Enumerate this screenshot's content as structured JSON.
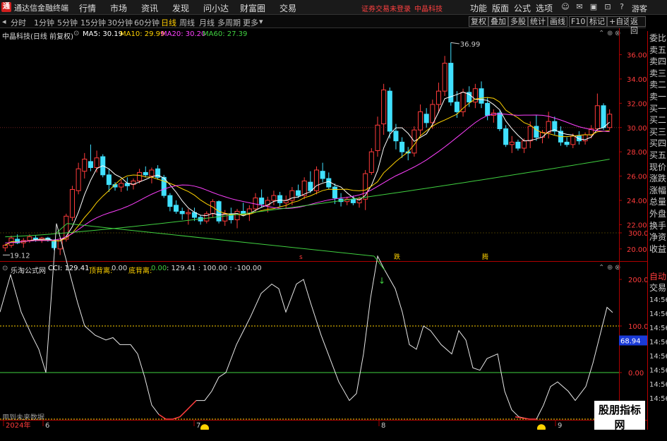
{
  "app": {
    "name": "通达信金融终端",
    "logo_char": "通"
  },
  "menu": [
    "行情",
    "市场",
    "资讯",
    "发现",
    "问小达",
    "财富圈",
    "交易"
  ],
  "login_status": "证券交易未登录",
  "stock_short": "中晶科技",
  "right_menu": [
    "功能",
    "版面",
    "公式",
    "选项"
  ],
  "guest": "游客",
  "periods": [
    "分时",
    "1分钟",
    "5分钟",
    "15分钟",
    "30分钟",
    "60分钟",
    "日线",
    "周线",
    "月线",
    "多周期",
    "更多"
  ],
  "active_period": "日线",
  "right_tools": [
    "复权",
    "叠加",
    "多股",
    "统计",
    "画线",
    "F10",
    "标记",
    "+自选",
    "返回"
  ],
  "main": {
    "title": "中晶科技(日线 前复权)",
    "ma": [
      {
        "label": "MA5: 30.19",
        "color": "#ffffff"
      },
      {
        "label": "MA10: 29.99",
        "color": "#ffd200"
      },
      {
        "label": "MA20: 30.20",
        "color": "#ff40ff"
      },
      {
        "label": "MA60: 27.39",
        "color": "#40d040"
      }
    ],
    "y_ticks": [
      "36.00",
      "34.00",
      "32.00",
      "30.00",
      "28.00",
      "26.00",
      "24.00",
      "22.00",
      "20.00"
    ],
    "high_label": "36.99",
    "low_label": "19.12",
    "markers": [
      "s",
      "跌",
      "腾"
    ]
  },
  "indicator": {
    "name": "乐淘公式网",
    "cci": "CCI: 129.41",
    "top_div_label": "顶背离:",
    "top_div_val": "0.00",
    "bot_div_label": "底背离:",
    "bot_div_val": "0.00",
    "rest": ": 129.41 : 100.00 : -100.00",
    "y_ticks": [
      "300.0",
      "200.0",
      "100.0",
      "0.00"
    ],
    "current_value": "68.94",
    "footer": "用到未来数据"
  },
  "x_axis": [
    "2024年",
    "6",
    "7",
    "8",
    "9"
  ],
  "side_panel": [
    "委比",
    "卖五",
    "卖四",
    "卖三",
    "卖二",
    "卖一",
    "买一",
    "买二",
    "买三",
    "买四",
    "买五",
    "现价",
    "涨跌",
    "涨幅",
    "总量",
    "外盘",
    "换手",
    "净资",
    "收益"
  ],
  "side_bottom": [
    "自动",
    "交易"
  ],
  "side_times": [
    "14:56",
    "14:56",
    "14:56",
    "14:56",
    "14:56",
    "14:56",
    "14:56",
    "14:56"
  ],
  "watermark": {
    "line1": "股朋指标网",
    "line2": "www.7gpzb.com"
  },
  "colors": {
    "up": "#ff3b3b",
    "down": "#40e0ff",
    "ma5": "#ffffff",
    "ma10": "#ffd200",
    "ma20": "#ff40ff",
    "ma60": "#40d040"
  },
  "chart_data": {
    "type": "candlestick",
    "price_ylim": [
      19.0,
      37.6
    ],
    "candles": [
      [
        20.1,
        20.4,
        19.8,
        20.3
      ],
      [
        20.3,
        21.1,
        20.1,
        20.9
      ],
      [
        20.8,
        21.2,
        20.4,
        20.5
      ],
      [
        20.5,
        20.9,
        20.1,
        20.7
      ],
      [
        20.7,
        21.2,
        20.5,
        21.0
      ],
      [
        20.9,
        21.1,
        20.6,
        20.8
      ],
      [
        20.8,
        21.0,
        20.5,
        20.9
      ],
      [
        20.9,
        21.0,
        20.6,
        20.7
      ],
      [
        20.6,
        20.8,
        19.9,
        20.1
      ],
      [
        20.0,
        20.9,
        19.5,
        20.8
      ],
      [
        20.8,
        22.9,
        20.6,
        22.7
      ],
      [
        22.6,
        25.2,
        22.3,
        24.9
      ],
      [
        24.8,
        27.1,
        24.5,
        26.6
      ],
      [
        26.4,
        27.9,
        25.8,
        27.4
      ],
      [
        27.2,
        28.6,
        26.4,
        26.7
      ],
      [
        26.7,
        28.1,
        26.3,
        27.5
      ],
      [
        27.6,
        27.8,
        25.9,
        26.1
      ],
      [
        26.1,
        26.6,
        24.7,
        25.3
      ],
      [
        25.3,
        25.5,
        24.8,
        25.1
      ],
      [
        25.1,
        25.7,
        24.7,
        25.4
      ],
      [
        25.4,
        25.9,
        24.8,
        25.2
      ],
      [
        25.3,
        25.8,
        24.9,
        25.6
      ],
      [
        25.6,
        26.6,
        25.4,
        26.3
      ],
      [
        26.3,
        26.8,
        25.9,
        26.1
      ],
      [
        26.0,
        26.7,
        25.4,
        26.5
      ],
      [
        26.6,
        26.9,
        25.7,
        25.9
      ],
      [
        25.9,
        26.1,
        24.2,
        24.4
      ],
      [
        24.4,
        24.6,
        23.1,
        23.5
      ],
      [
        23.6,
        24.0,
        22.9,
        23.1
      ],
      [
        23.1,
        23.4,
        22.4,
        22.9
      ],
      [
        22.9,
        23.3,
        22.0,
        23.0
      ],
      [
        23.0,
        23.4,
        22.3,
        22.6
      ],
      [
        22.6,
        22.8,
        22.0,
        22.3
      ],
      [
        22.3,
        23.1,
        22.1,
        22.9
      ],
      [
        22.9,
        24.1,
        22.6,
        23.9
      ],
      [
        23.9,
        24.0,
        22.1,
        22.3
      ],
      [
        22.3,
        23.2,
        21.9,
        22.9
      ],
      [
        22.9,
        23.4,
        22.1,
        22.4
      ],
      [
        22.4,
        23.3,
        21.7,
        23.1
      ],
      [
        23.1,
        23.8,
        22.7,
        22.9
      ],
      [
        22.9,
        23.6,
        22.3,
        23.3
      ],
      [
        23.3,
        24.6,
        23.0,
        24.2
      ],
      [
        24.2,
        24.9,
        23.4,
        23.7
      ],
      [
        23.6,
        24.3,
        23.0,
        24.0
      ],
      [
        24.0,
        24.8,
        23.6,
        24.4
      ],
      [
        24.4,
        24.7,
        23.5,
        23.8
      ],
      [
        23.8,
        24.4,
        23.3,
        24.0
      ],
      [
        24.0,
        25.1,
        23.6,
        24.8
      ],
      [
        24.8,
        25.3,
        24.2,
        24.4
      ],
      [
        24.4,
        25.9,
        24.1,
        25.6
      ],
      [
        25.5,
        26.4,
        24.6,
        24.8
      ],
      [
        24.8,
        26.8,
        24.5,
        26.5
      ],
      [
        26.4,
        27.1,
        25.5,
        25.8
      ],
      [
        25.8,
        26.3,
        24.9,
        25.1
      ],
      [
        25.1,
        25.4,
        23.7,
        24.2
      ],
      [
        24.1,
        24.6,
        23.5,
        23.9
      ],
      [
        23.9,
        24.3,
        23.6,
        24.1
      ],
      [
        24.1,
        24.4,
        23.6,
        23.8
      ],
      [
        23.8,
        24.3,
        23.4,
        24.1
      ],
      [
        24.1,
        26.5,
        23.2,
        26.2
      ],
      [
        26.3,
        28.3,
        26.1,
        28.0
      ],
      [
        28.1,
        30.9,
        27.6,
        30.2
      ],
      [
        30.3,
        33.6,
        29.4,
        33.1
      ],
      [
        33.0,
        33.3,
        29.1,
        29.7
      ],
      [
        29.7,
        30.3,
        28.2,
        28.9
      ],
      [
        28.8,
        29.2,
        27.5,
        28.0
      ],
      [
        28.0,
        28.4,
        27.3,
        27.9
      ],
      [
        27.9,
        30.1,
        27.6,
        29.8
      ],
      [
        29.8,
        31.9,
        29.3,
        31.3
      ],
      [
        31.1,
        31.6,
        30.0,
        30.4
      ],
      [
        30.4,
        32.3,
        29.9,
        31.9
      ],
      [
        31.9,
        33.7,
        31.2,
        33.0
      ],
      [
        33.0,
        35.9,
        32.6,
        35.3
      ],
      [
        35.3,
        37.0,
        31.8,
        32.1
      ],
      [
        32.1,
        33.0,
        30.8,
        31.3
      ],
      [
        31.3,
        33.2,
        30.9,
        32.9
      ],
      [
        32.9,
        33.4,
        31.7,
        32.1
      ],
      [
        32.1,
        33.6,
        31.6,
        33.2
      ],
      [
        33.2,
        33.8,
        31.6,
        32.0
      ],
      [
        32.0,
        32.5,
        30.6,
        31.0
      ],
      [
        31.0,
        31.5,
        30.4,
        31.2
      ],
      [
        31.2,
        31.4,
        29.7,
        29.9
      ],
      [
        29.9,
        30.2,
        28.4,
        28.6
      ],
      [
        28.6,
        29.3,
        27.9,
        28.8
      ],
      [
        28.8,
        29.0,
        28.1,
        28.3
      ],
      [
        28.3,
        29.1,
        27.9,
        28.9
      ],
      [
        28.9,
        30.5,
        28.3,
        30.1
      ],
      [
        30.1,
        31.0,
        28.9,
        29.2
      ],
      [
        29.2,
        29.8,
        28.7,
        29.6
      ],
      [
        29.6,
        31.3,
        29.1,
        30.5
      ],
      [
        30.5,
        30.9,
        29.4,
        29.7
      ],
      [
        29.7,
        30.1,
        28.5,
        28.8
      ],
      [
        28.8,
        29.2,
        28.4,
        28.6
      ],
      [
        28.6,
        29.5,
        28.3,
        29.3
      ],
      [
        29.3,
        29.7,
        28.6,
        28.9
      ],
      [
        28.9,
        29.6,
        28.6,
        29.4
      ],
      [
        29.4,
        30.2,
        29.1,
        29.9
      ],
      [
        29.9,
        32.8,
        29.7,
        31.8
      ],
      [
        31.8,
        32.0,
        29.8,
        30.0
      ],
      [
        30.0,
        31.5,
        29.8,
        31.1
      ]
    ],
    "cci": [
      [
        0,
        130
      ],
      [
        15,
        210
      ],
      [
        30,
        130
      ],
      [
        45,
        80
      ],
      [
        55,
        50
      ],
      [
        65,
        0
      ],
      [
        80,
        320
      ],
      [
        110,
        150
      ],
      [
        120,
        100
      ],
      [
        135,
        80
      ],
      [
        150,
        70
      ],
      [
        160,
        75
      ],
      [
        170,
        60
      ],
      [
        185,
        60
      ],
      [
        195,
        40
      ],
      [
        205,
        -10
      ],
      [
        215,
        -70
      ],
      [
        225,
        -90
      ],
      [
        235,
        -100
      ],
      [
        245,
        -100
      ],
      [
        255,
        -95
      ],
      [
        265,
        -80
      ],
      [
        278,
        -60
      ],
      [
        290,
        -60
      ],
      [
        300,
        -40
      ],
      [
        310,
        -10
      ],
      [
        320,
        0
      ],
      [
        335,
        60
      ],
      [
        345,
        90
      ],
      [
        355,
        120
      ],
      [
        370,
        170
      ],
      [
        385,
        190
      ],
      [
        395,
        180
      ],
      [
        405,
        130
      ],
      [
        420,
        190
      ],
      [
        430,
        200
      ],
      [
        440,
        150
      ],
      [
        455,
        80
      ],
      [
        465,
        40
      ],
      [
        480,
        -20
      ],
      [
        495,
        -60
      ],
      [
        505,
        -45
      ],
      [
        515,
        40
      ],
      [
        525,
        160
      ],
      [
        535,
        250
      ],
      [
        545,
        220
      ],
      [
        560,
        180
      ],
      [
        570,
        130
      ],
      [
        580,
        60
      ],
      [
        590,
        50
      ],
      [
        600,
        100
      ],
      [
        610,
        90
      ],
      [
        625,
        60
      ],
      [
        640,
        40
      ],
      [
        650,
        90
      ],
      [
        660,
        70
      ],
      [
        670,
        10
      ],
      [
        680,
        5
      ],
      [
        690,
        30
      ],
      [
        705,
        40
      ],
      [
        715,
        -40
      ],
      [
        725,
        -80
      ],
      [
        735,
        -95
      ],
      [
        750,
        -100
      ],
      [
        760,
        -100
      ],
      [
        770,
        -70
      ],
      [
        780,
        -30
      ],
      [
        790,
        -20
      ],
      [
        805,
        -40
      ],
      [
        815,
        -60
      ],
      [
        830,
        -30
      ],
      [
        840,
        20
      ],
      [
        850,
        80
      ],
      [
        860,
        140
      ],
      [
        868,
        129
      ]
    ]
  }
}
